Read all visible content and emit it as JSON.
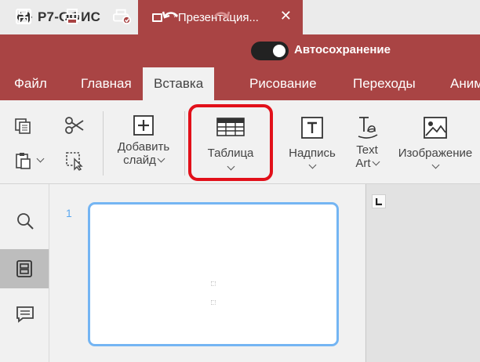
{
  "app": {
    "logo_text": "Р7-ОФИС"
  },
  "document_tab": {
    "title": "*Презентация...",
    "close_glyph": "✕"
  },
  "quick_toolbar": {
    "autosave_label": "Автосохранение",
    "autosave_on": true
  },
  "tabs": [
    {
      "label": "Файл",
      "active": false
    },
    {
      "label": "Главная",
      "active": false
    },
    {
      "label": "Вставка",
      "active": true
    },
    {
      "label": "Рисование",
      "active": false
    },
    {
      "label": "Переходы",
      "active": false
    },
    {
      "label": "Анимация",
      "active": false
    }
  ],
  "ribbon": {
    "add_slide": {
      "line1": "Добавить",
      "line2": "слайд"
    },
    "table": {
      "label": "Таблица"
    },
    "text_box": {
      "label": "Надпись"
    },
    "text_art": {
      "line1": "Text",
      "line2": "Art"
    },
    "image": {
      "label": "Изображение"
    }
  },
  "slides_panel": {
    "slide_number": "1"
  },
  "colors": {
    "accent": "#a94444",
    "highlight": "#e2101a",
    "selection": "#74b5f3"
  }
}
